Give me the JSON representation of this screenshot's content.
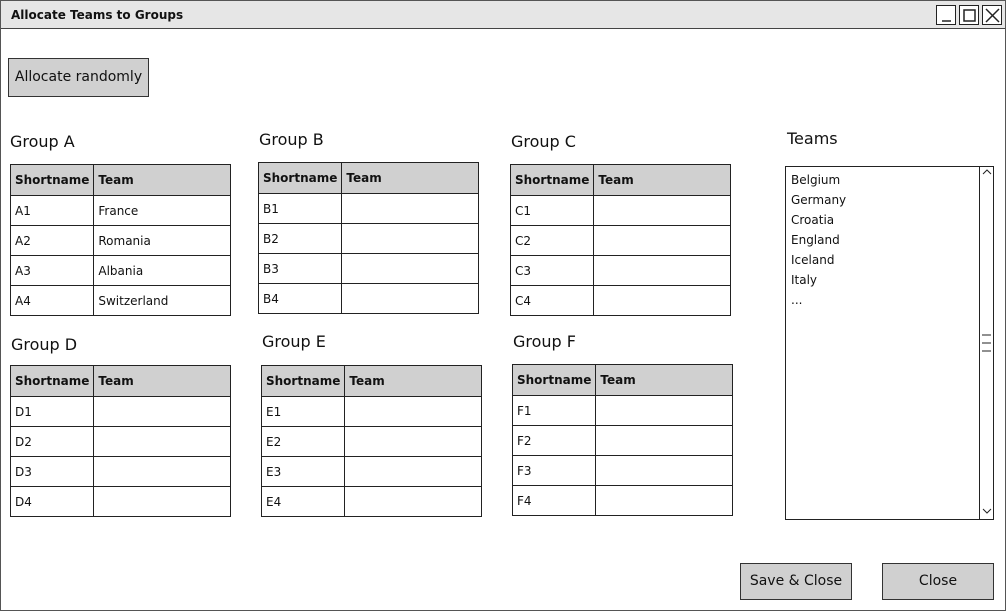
{
  "window": {
    "title": "Allocate Teams to Groups"
  },
  "buttons": {
    "allocate": "Allocate randomly",
    "save_close": "Save & Close",
    "close": "Close"
  },
  "table_headers": {
    "shortname": "Shortname",
    "team": "Team"
  },
  "groups": [
    {
      "title": "Group A",
      "rows": [
        {
          "short": "A1",
          "team": "France"
        },
        {
          "short": "A2",
          "team": "Romania"
        },
        {
          "short": "A3",
          "team": "Albania"
        },
        {
          "short": "A4",
          "team": "Switzerland"
        }
      ]
    },
    {
      "title": "Group B",
      "rows": [
        {
          "short": "B1",
          "team": ""
        },
        {
          "short": "B2",
          "team": ""
        },
        {
          "short": "B3",
          "team": ""
        },
        {
          "short": "B4",
          "team": ""
        }
      ]
    },
    {
      "title": "Group C",
      "rows": [
        {
          "short": "C1",
          "team": ""
        },
        {
          "short": "C2",
          "team": ""
        },
        {
          "short": "C3",
          "team": ""
        },
        {
          "short": "C4",
          "team": ""
        }
      ]
    },
    {
      "title": "Group D",
      "rows": [
        {
          "short": "D1",
          "team": ""
        },
        {
          "short": "D2",
          "team": ""
        },
        {
          "short": "D3",
          "team": ""
        },
        {
          "short": "D4",
          "team": ""
        }
      ]
    },
    {
      "title": "Group E",
      "rows": [
        {
          "short": "E1",
          "team": ""
        },
        {
          "short": "E2",
          "team": ""
        },
        {
          "short": "E3",
          "team": ""
        },
        {
          "short": "E4",
          "team": ""
        }
      ]
    },
    {
      "title": "Group F",
      "rows": [
        {
          "short": "F1",
          "team": ""
        },
        {
          "short": "F2",
          "team": ""
        },
        {
          "short": "F3",
          "team": ""
        },
        {
          "short": "F4",
          "team": ""
        }
      ]
    }
  ],
  "teams": {
    "title": "Teams",
    "items": [
      "Belgium",
      "Germany",
      "Croatia",
      "England",
      "Iceland",
      "Italy",
      "..."
    ]
  }
}
